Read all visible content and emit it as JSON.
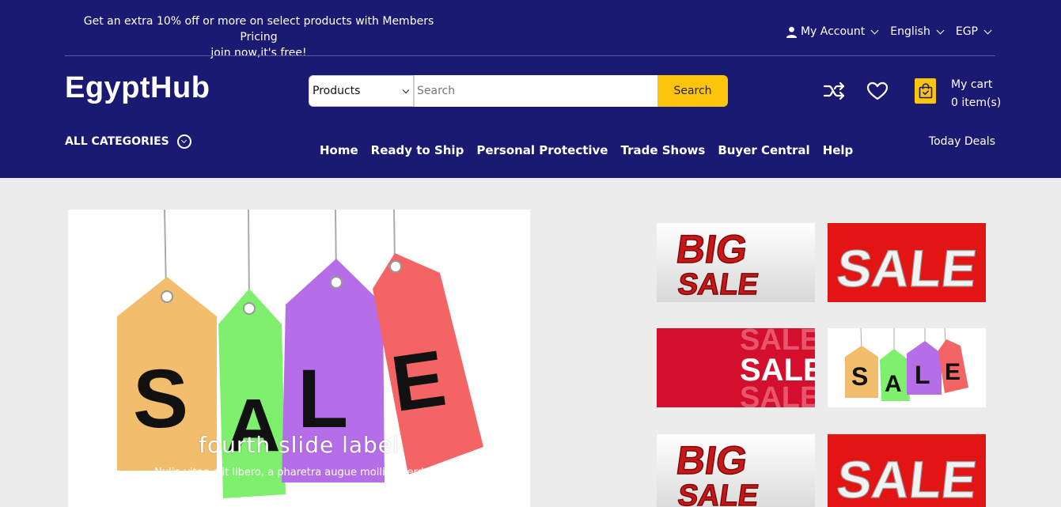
{
  "header": {
    "promo_line1": "Get an extra 10% off or more on select products with Members Pricing",
    "promo_line2": "join now,it's free!",
    "account_label": "My Account",
    "language_label": "English",
    "currency_label": "EGP",
    "logo_text": "EgyptHub"
  },
  "search": {
    "category_value": "Products",
    "placeholder": "Search",
    "button_label": "Search"
  },
  "cart": {
    "label": "My cart",
    "count_text": "0 item(s)"
  },
  "categories": {
    "label": "ALL CATEGORIES"
  },
  "nav": {
    "items": [
      {
        "label": "Home"
      },
      {
        "label": "Ready to Ship"
      },
      {
        "label": "Personal Protective"
      },
      {
        "label": "Trade Shows"
      },
      {
        "label": "Buyer Central"
      },
      {
        "label": "Help"
      }
    ],
    "today_deals": "Today Deals"
  },
  "hero": {
    "slide_title": "fourth slide label",
    "slide_caption": "Nulla vitae elit libero, a pharetra augue mollis interdum.",
    "tag_letters": [
      "S",
      "A",
      "L",
      "E"
    ]
  },
  "thumbs": {
    "big_top": "BIG",
    "big_bottom": "SALE",
    "sale_white": "SALE",
    "sale_banner": "SALE",
    "tags_letters": [
      "S",
      "A",
      "L",
      "E"
    ]
  },
  "colors": {
    "header_bg": "#1b1a72",
    "accent": "#fcc40b",
    "page_bg": "#ececec"
  },
  "icons": [
    "user-icon",
    "shuffle-icon",
    "heart-icon",
    "cart-bag-icon",
    "chevron-down-icon"
  ]
}
